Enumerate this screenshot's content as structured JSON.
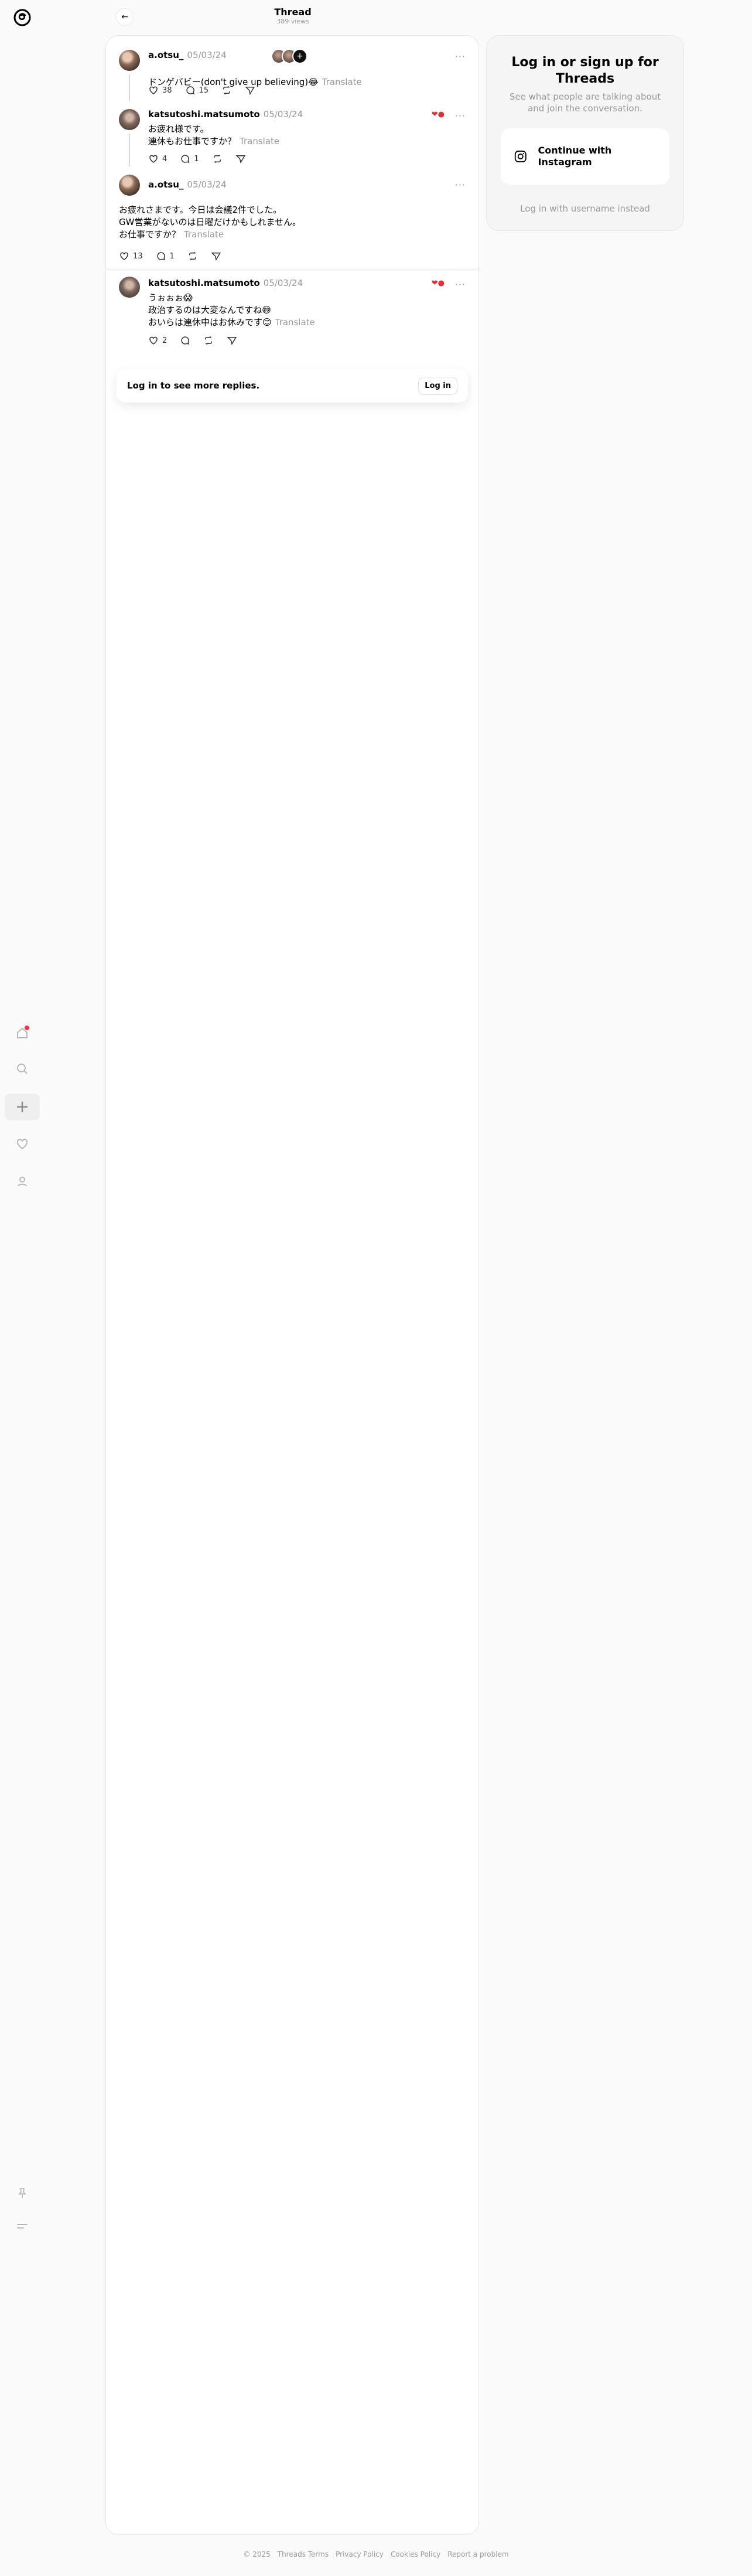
{
  "header": {
    "title": "Thread",
    "views": "389 views",
    "back_icon": "arrow-left-icon"
  },
  "nav": {
    "items": [
      {
        "name": "home-icon",
        "notification": true
      },
      {
        "name": "search-icon"
      },
      {
        "name": "create-icon",
        "active": true
      },
      {
        "name": "heart-icon"
      },
      {
        "name": "profile-icon"
      }
    ],
    "bottom": [
      {
        "name": "pin-icon"
      },
      {
        "name": "menu-icon"
      }
    ]
  },
  "posts": [
    {
      "username": "a.otsu_",
      "date": "05/03/24",
      "text": "ドンゲバビー(don't give up believing)😂",
      "translate": "Translate",
      "likes": "38",
      "replies": "15"
    },
    {
      "username": "katsutoshi.matsumoto",
      "date": "05/03/24",
      "text": "お疲れ様です。\n連休もお仕事ですか？",
      "translate": "Translate",
      "likes": "4",
      "replies": "1"
    },
    {
      "username": "a.otsu_",
      "date": "05/03/24",
      "text": "お疲れさまです。今日は会議2件でした。\nGW営業がないのは日曜だけかもしれません。\nお仕事ですか？",
      "translate": "Translate",
      "likes": "13",
      "replies": "1"
    },
    {
      "username": "katsutoshi.matsumoto",
      "date": "05/03/24",
      "text": "うぉぉぉ😱\n政治するのは大変なんですね😅\nおいらは連休中はお休みです😊",
      "translate": "Translate",
      "likes": "2",
      "replies": ""
    }
  ],
  "more_replies": {
    "text": "Log in to see more replies.",
    "button": "Log in"
  },
  "sidebar": {
    "title": "Log in or sign up for Threads",
    "subtitle": "See what people are talking about and join the conversation.",
    "instagram_button": "Continue with Instagram",
    "username_link": "Log in with username instead"
  },
  "footer": {
    "links": [
      "© 2025",
      "Threads Terms",
      "Privacy Policy",
      "Cookies Policy",
      "Report a problem"
    ]
  },
  "colors": {
    "accent": "#ff3040",
    "muted": "#999999",
    "card": "#ffffff",
    "background": "#fafafa"
  }
}
